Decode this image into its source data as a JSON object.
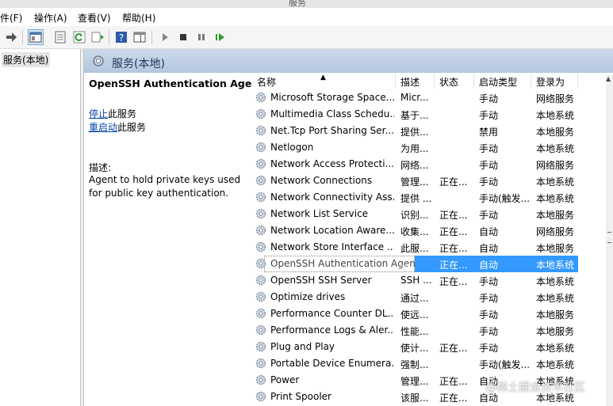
{
  "window": {
    "title": "服务"
  },
  "menu": [
    "件(F)",
    "操作(A)",
    "查看(V)",
    "帮助(H)"
  ],
  "tree": {
    "root": "服务(本地)"
  },
  "pane": {
    "title": "服务(本地)"
  },
  "detail": {
    "service_name": "OpenSSH Authentication Agent",
    "stop_link": "停止",
    "stop_suffix": "此服务",
    "restart_link": "重启动",
    "restart_suffix": "此服务",
    "desc_label": "描述:",
    "desc_text": "Agent to hold private keys used for public key authentication."
  },
  "columns": {
    "name": "名称",
    "desc": "描述",
    "status": "状态",
    "startup": "启动类型",
    "logon": "登录为"
  },
  "rows": [
    {
      "name": "Microsoft Storage Space...",
      "desc": "Micr...",
      "status": "",
      "startup": "手动",
      "logon": "网络服务"
    },
    {
      "name": "Multimedia Class Schedu...",
      "desc": "基于...",
      "status": "",
      "startup": "手动",
      "logon": "本地系统"
    },
    {
      "name": "Net.Tcp Port Sharing Ser...",
      "desc": "提供...",
      "status": "",
      "startup": "禁用",
      "logon": "本地服务"
    },
    {
      "name": "Netlogon",
      "desc": "为用...",
      "status": "",
      "startup": "手动",
      "logon": "本地系统"
    },
    {
      "name": "Network Access Protecti...",
      "desc": "网络...",
      "status": "",
      "startup": "手动",
      "logon": "网络服务"
    },
    {
      "name": "Network Connections",
      "desc": "管理...",
      "status": "正在...",
      "startup": "手动",
      "logon": "本地系统"
    },
    {
      "name": "Network Connectivity Ass...",
      "desc": "提供 ...",
      "status": "",
      "startup": "手动(触发...",
      "logon": "本地系统"
    },
    {
      "name": "Network List Service",
      "desc": "识别...",
      "status": "正在...",
      "startup": "手动",
      "logon": "本地服务"
    },
    {
      "name": "Network Location Aware...",
      "desc": "收集...",
      "status": "正在...",
      "startup": "自动",
      "logon": "网络服务"
    },
    {
      "name": "Network Store Interface ...",
      "desc": "此服...",
      "status": "正在...",
      "startup": "自动",
      "logon": "本地服务"
    },
    {
      "name": "OpenSSH Authentication Agent",
      "desc": "...",
      "status": "正在...",
      "startup": "自动",
      "logon": "本地系统"
    },
    {
      "name": "OpenSSH SSH Server",
      "desc": "SSH ...",
      "status": "正在...",
      "startup": "手动",
      "logon": "本地系统"
    },
    {
      "name": "Optimize drives",
      "desc": "通过...",
      "status": "",
      "startup": "手动",
      "logon": "本地系统"
    },
    {
      "name": "Performance Counter DL...",
      "desc": "使远...",
      "status": "",
      "startup": "手动",
      "logon": "本地服务"
    },
    {
      "name": "Performance Logs & Aler...",
      "desc": "性能...",
      "status": "",
      "startup": "手动",
      "logon": "本地服务"
    },
    {
      "name": "Plug and Play",
      "desc": "使计...",
      "status": "正在...",
      "startup": "手动",
      "logon": "本地系统"
    },
    {
      "name": "Portable Device Enumera...",
      "desc": "强制...",
      "status": "",
      "startup": "手动(触发...",
      "logon": "本地系统"
    },
    {
      "name": "Power",
      "desc": "管理...",
      "status": "正在...",
      "startup": "自动",
      "logon": "本地系统"
    },
    {
      "name": "Print Spooler",
      "desc": "该服...",
      "status": "正在...",
      "startup": "自动",
      "logon": "本地系统"
    }
  ],
  "selected_index": 10,
  "watermark": "@稀土掘金技术社区",
  "colors": {
    "selection": "#3399ff",
    "header_band": "#b4c6de",
    "link": "#0645ad"
  }
}
